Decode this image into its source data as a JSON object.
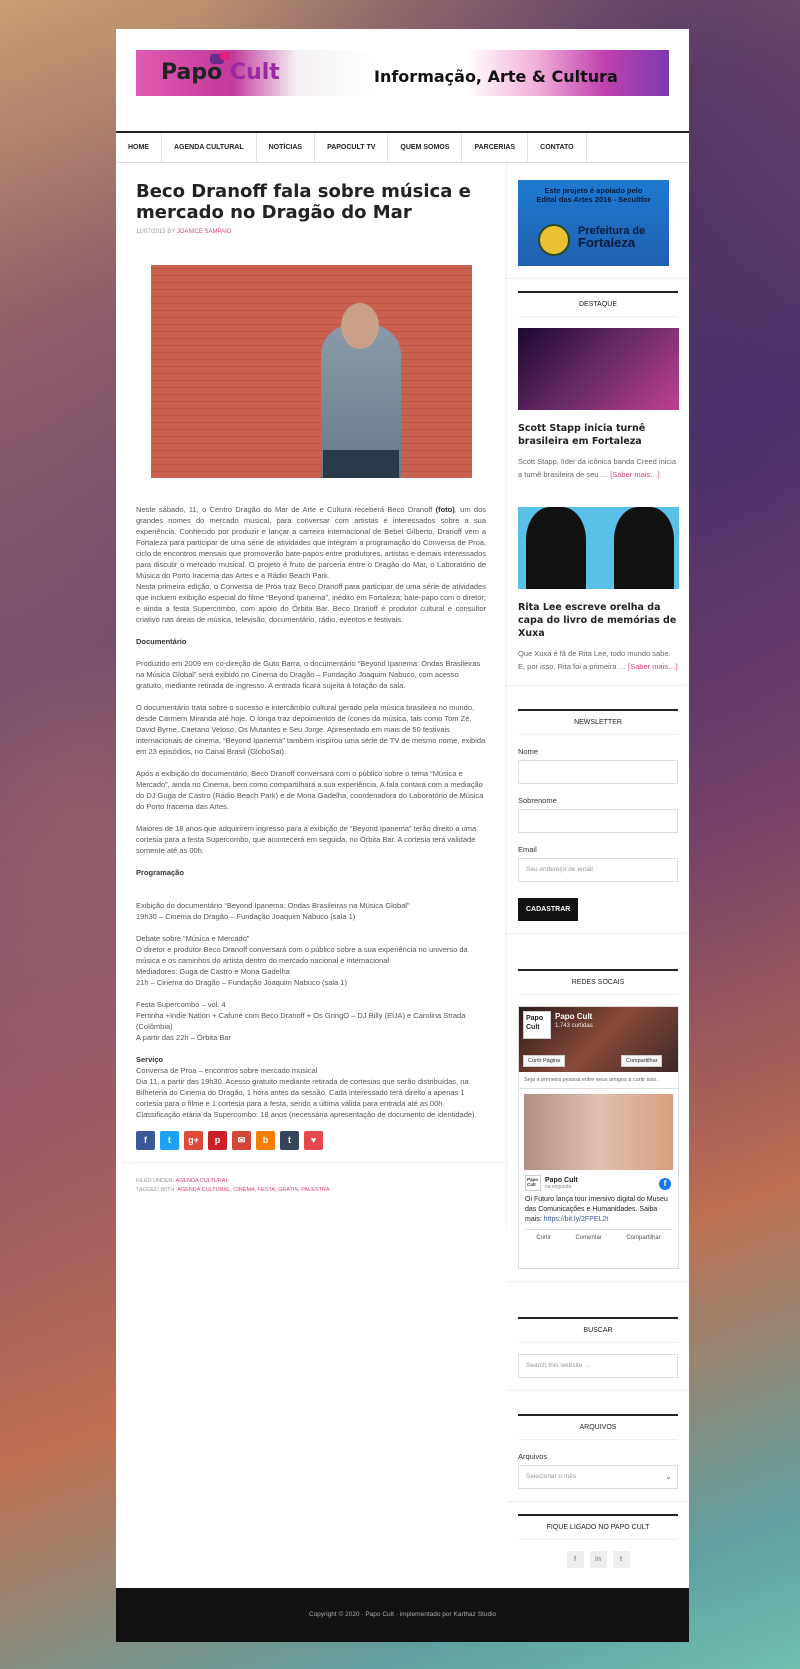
{
  "header": {
    "logo_papo": "Papo",
    "logo_cult": "Cult",
    "tagline": "Informação, Arte & Cultura"
  },
  "nav": {
    "items": [
      "HOME",
      "AGENDA CULTURAL",
      "NOTÍCIAS",
      "PAPOCULT TV",
      "QUEM SOMOS",
      "PARCERIAS",
      "CONTATO"
    ]
  },
  "article": {
    "title": "Beco Dranoff fala sobre música e mercado no Dragão do Mar",
    "date": "11/07/2015",
    "by": "BY",
    "author": "JOANICE SAMPAIO",
    "p1_a": "  Neste sábado, 11, o Centro Dragão do Mar de Arte e Cultura receberá Beco Dranoff ",
    "p1_foto": "(foto)",
    "p1_b": ", um dos grandes nomes do mercado musical, para conversar com artistas e interessados sobre a sua experiência. Conhecido por produzir e lançar a carreira internacional de Bebel Gilberto, Dranoff vem a Fortaleza para participar de uma série de atividades que integram a programação do Conversa de Proa, ciclo de encontros mensais que promoverão bate-papos entre produtores, artistas e demais interessados para discutir o mercado musical. O projeto é fruto de parceria entre o Dragão do Mar, o Laboratório de Música do Porto Iracema das Artes e a Rádio Beach Park.",
    "p2": "Nesta primeira edição, o Conversa de Proa traz Beco Dranoff para participar de uma série de atividades que incluem exibição especial do filme “Beyond Ipanema”, inédito em Fortaleza; bate-papo com o diretor; e ainda a festa Supercombo, com apoio do Órbita Bar. Beco Dranoff é produtor cultural e consultor criativo nas áreas de música, televisão, documentário, rádio, eventos e festivais.",
    "h_documentario": "Documentário",
    "p3": "Produzido em 2009 em co-direção de Guto Barra, o documentário “Beyond Ipanema: Ondas Brasileiras na Música Global” será exibido no Cinema do Dragão – Fundação Joaquim Nabuco, com acesso gratuito, mediante retirada de ingresso. A entrada ficará sujeita à lotação da sala.",
    "p4": " O documentário trata sobre o sucesso e intercâmbio cultural gerado pela música brasileira no mundo, desde Carmem Miranda até hoje. O longa traz depoimentos de ícones da música, tais como Tom Zé, David Byrne, Caetano Veloso, Os Mutantes e Seu Jorge. Apresentado em mais de 50 festivais internacionais de cinema, “Beyond Ipanema” também inspirou uma série de TV de mesmo nome, exibida em 23 episódios, no Canal Brasil (GloboSat).",
    "p5": " Após a exibição do documentário, Beco Dranoff conversará com o público sobre o tema “Música e Mercado”, ainda no Cinema, bem como compartilhará a sua experiência. A fala contará com a mediação do DJ Guga de Castro (Rádio Beach Park) e de Mona Gadelha, coordenadora do Laboratório de Música do Porto Iracema das Artes.",
    "p6": " Maiores de 18 anos que adquirirem ingresso para a exibição de “Beyond Ipanema” terão direito a uma cortesia para a festa Supercombo, que acontecerá em seguida, no Órbita Bar. A cortesia terá validade somente até as 00h.",
    "h_programacao": "Programação",
    "prog1_a": "Exibição do documentário  “Beyond Ipanema: Ondas Brasileiras na Música Global”",
    "prog1_b": "19h30 – Cinema do Dragão – Fundação Joaquim Nabuco (sala 1)",
    "prog2_a": "Debate sobre “Música e Mercado”",
    "prog2_b": "O diretor e produtor Beco Dranoff conversará com o público sobre a sua experiência no universo da música e os caminhos do artista dentro do mercado nacional e internacional",
    "prog2_c": "Mediadores: Guga de Castro e Mona Gadelha",
    "prog2_d": "21h – Cinema do Dragão – Fundação Joaquim Nabuco (sala 1)",
    "prog3_a": "Festa Supercombo – vol. 4",
    "prog3_b": "Fertinha +Indie Nation + Cafuné com Beco Dranoff + Os GringO – DJ Billy (EUA) e Carolina Strada (Colômbia)",
    "prog3_c": "A partir das 22h – Órbita Bar",
    "h_servico": "Serviço",
    "serv1": "Conversa de Proa – encontros sobre mercado musical",
    "serv2": "Dia 11, a partir das 19h30. Acesso gratuito mediante retirada de cortesias que serão distribuídas, na Bilheteria do Cinema do Dragão, 1 hora antes da sessão. Cada interessado terá direito a apenas 1 cortesia para o filme e 1 cortesia para a festa, sendo a última válida para entrada até as 00h. Classificação etária da Supercombo: 18 anos (necessária apresentação de documento de identidade).",
    "filed_label": "FILED UNDER:",
    "filed_cat": "AGENDA CULTURAL",
    "tagged_label": "TAGGED WITH:",
    "tags": "AGENDA CULTURAL, CINEMA, FESTA, GRATIS, PALESTRA"
  },
  "share": {
    "buttons": [
      {
        "icon": "f",
        "color": "#3b5998"
      },
      {
        "icon": "t",
        "color": "#1da1f2"
      },
      {
        "icon": "g+",
        "color": "#dd4b39"
      },
      {
        "icon": "p",
        "color": "#cb2027"
      },
      {
        "icon": "✉",
        "color": "#d44638"
      },
      {
        "icon": "b",
        "color": "#f57d00"
      },
      {
        "icon": "t",
        "color": "#35465c"
      },
      {
        "icon": "♥",
        "color": "#e5484d"
      }
    ]
  },
  "sidebar": {
    "ad_line1": "Este projeto é apoiado pelo",
    "ad_line2": "Edital das Artes 2016 - Secultfor",
    "ad_prefeitura": "Prefeitura de",
    "ad_fortaleza": "Fortaleza",
    "destaque_title": "DESTAQUE",
    "post1_title": "Scott Stapp inicia turnê brasileira em Fortaleza",
    "post1_excerpt": "Scott Stapp, líder da icônica banda Creed inicia a turnê brasileira de seu … ",
    "post2_title": "Rita Lee escreve orelha da capa do livro de memórias de Xuxa",
    "post2_excerpt": "Que Xuxa é fã de Rita Lee, todo mundo sabe. E, por isso, Rita foi a primeira … ",
    "saber_mais": "[Saber mais…]",
    "newsletter_title": "NEWSLETTER",
    "nome_label": "Nome",
    "sobrenome_label": "Sobrenome",
    "email_label": "Email",
    "email_placeholder": "Seu endereço de email",
    "subscribe_label": "CADASTRAR",
    "redes_title": "REDES SOCAIS",
    "fb_name": "Papo Cult",
    "fb_count": "1.743 curtidas",
    "fb_like": "Curtir Página",
    "fb_share": "Compartilhar",
    "fb_note": "Seja a primeira pessoa entre seus amigos a curtir isso.",
    "fb_post_name": "Papo Cult",
    "fb_post_sub": "na segunda",
    "fb_post_text": "Oi Futuro lança tour imersivo digital do Museu das Comunicações e Humanidades. Saiba mais: ",
    "fb_post_link": "https://bit.ly/2FPEL2t",
    "fb_action1": "Curtir",
    "fb_action2": "Comentar",
    "fb_action3": "Compartilhar",
    "buscar_title": "BUSCAR",
    "search_placeholder": "Search this website …",
    "arquivos_title": "ARQUIVOS",
    "arquivos_label": "Arquivos",
    "select_value": "Selecionar o mês",
    "ligado_title": "FIQUE LIGADO NO PAPO CULT"
  },
  "footer": {
    "text": "Copyright © 2020 · Papo Cult · implementado por Karthaz Studio"
  }
}
